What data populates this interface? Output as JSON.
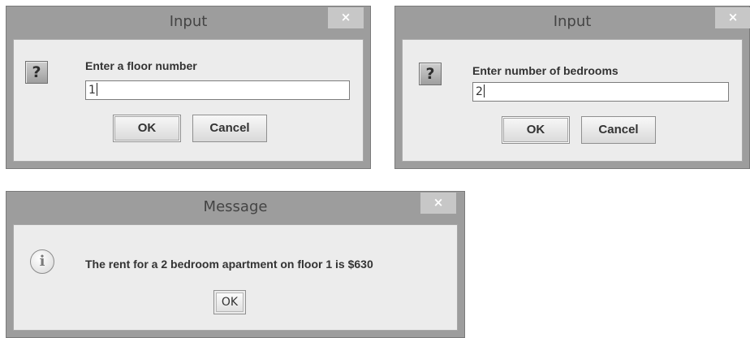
{
  "dialog_floor": {
    "title": "Input",
    "close_glyph": "×",
    "icon_glyph": "?",
    "prompt": "Enter a floor number",
    "input_value": "1",
    "ok_label": "OK",
    "cancel_label": "Cancel"
  },
  "dialog_bedrooms": {
    "title": "Input",
    "close_glyph": "×",
    "icon_glyph": "?",
    "prompt": "Enter number of bedrooms",
    "input_value": "2",
    "ok_label": "OK",
    "cancel_label": "Cancel"
  },
  "dialog_message": {
    "title": "Message",
    "close_glyph": "×",
    "icon_glyph": "i",
    "message": "The rent for a 2 bedroom apartment on floor 1 is $630",
    "ok_label": "OK"
  },
  "colors": {
    "frame": "#9d9d9d",
    "close_button": "#c7c7c7",
    "client_background": "#ececec"
  },
  "icons": [
    "question-icon",
    "information-icon",
    "close-icon"
  ]
}
